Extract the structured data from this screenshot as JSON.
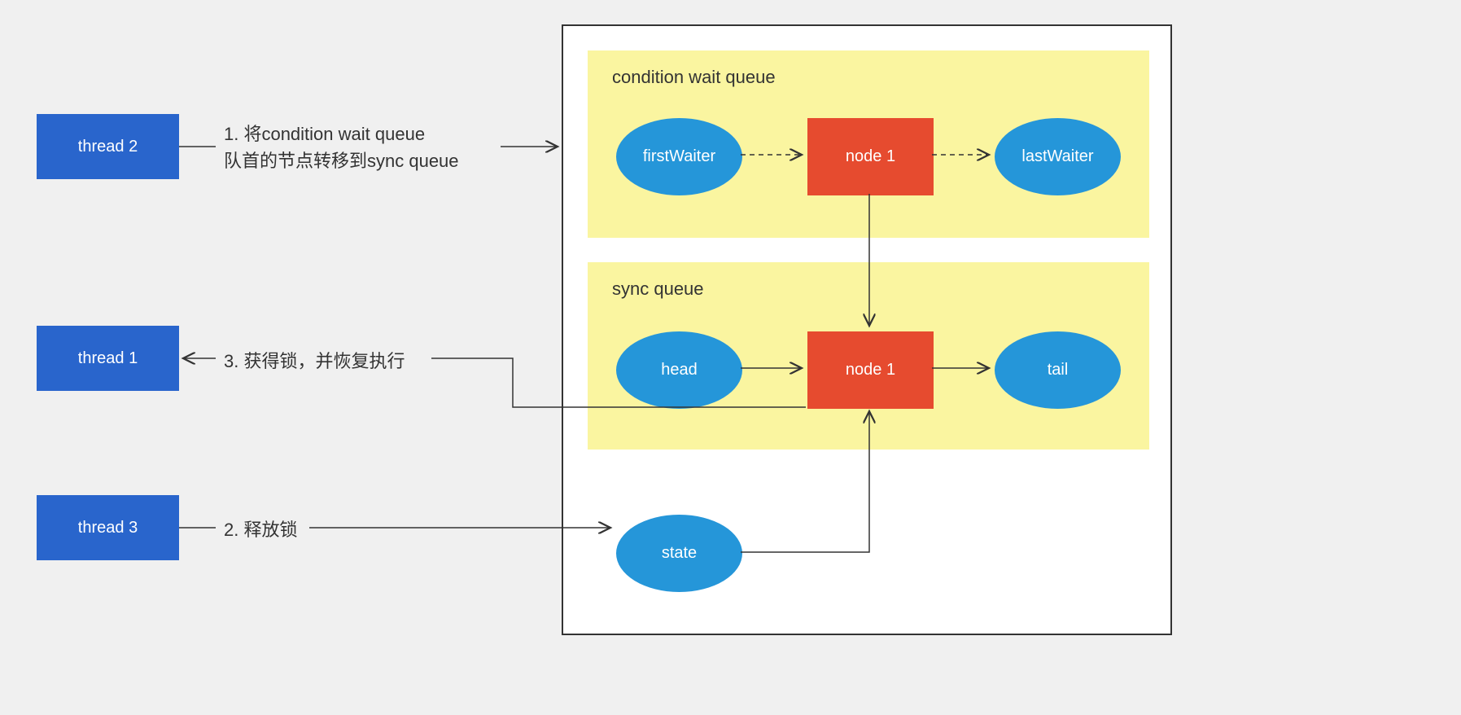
{
  "threads": {
    "t2": "thread 2",
    "t1": "thread 1",
    "t3": "thread 3"
  },
  "labels": {
    "step1_line1": "1. 将condition wait queue",
    "step1_line2": "队首的节点转移到sync queue",
    "step3": "3. 获得锁，并恢复执行",
    "step2": "2. 释放锁"
  },
  "queues": {
    "condition_title": "condition wait queue",
    "sync_title": "sync queue"
  },
  "nodes": {
    "firstWaiter": "firstWaiter",
    "node1_top": "node 1",
    "lastWaiter": "lastWaiter",
    "head": "head",
    "node1_bottom": "node 1",
    "tail": "tail",
    "state": "state"
  },
  "colors": {
    "thread_bg": "#2965cc",
    "ellipse_bg": "#2596d9",
    "node_bg": "#e64b2f",
    "queue_bg": "#faf5a0",
    "page_bg": "#f0f0f0"
  }
}
